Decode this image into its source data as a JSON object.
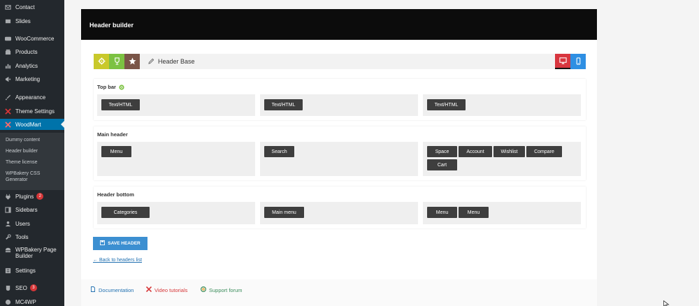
{
  "sidebar": {
    "items": [
      {
        "label": "Contact",
        "icon": "mail-icon"
      },
      {
        "label": "Slides",
        "icon": "slides-icon"
      },
      {
        "label": "WooCommerce",
        "icon": "woocommerce-icon"
      },
      {
        "label": "Products",
        "icon": "products-icon"
      },
      {
        "label": "Analytics",
        "icon": "analytics-icon"
      },
      {
        "label": "Marketing",
        "icon": "megaphone-icon"
      },
      {
        "label": "Appearance",
        "icon": "brush-icon"
      },
      {
        "label": "Theme Settings",
        "icon": "theme-settings-icon"
      },
      {
        "label": "WoodMart",
        "icon": "woodmart-icon"
      },
      {
        "label": "Plugins",
        "icon": "plugin-icon",
        "badge": "2"
      },
      {
        "label": "Sidebars",
        "icon": "sidebars-icon"
      },
      {
        "label": "Users",
        "icon": "users-icon"
      },
      {
        "label": "Tools",
        "icon": "wrench-icon"
      },
      {
        "label": "WPBakery Page Builder",
        "icon": "wpbakery-icon"
      },
      {
        "label": "Settings",
        "icon": "settings-icon"
      },
      {
        "label": "SEO",
        "icon": "seo-icon",
        "badge": "3"
      },
      {
        "label": "MC4WP",
        "icon": "mc4wp-icon"
      }
    ],
    "submenu": [
      "Dummy content",
      "Header builder",
      "Theme license",
      "WPBakery CSS Generator"
    ]
  },
  "panel": {
    "title": "Header builder",
    "toolbar": {
      "base_label": "Header Base",
      "left_icons": [
        "gear-icon",
        "trophy-icon",
        "star-icon"
      ],
      "right_icons": [
        "desktop-icon",
        "mobile-icon"
      ]
    },
    "sections": [
      {
        "title": "Top bar",
        "columns": [
          [
            "Text/HTML"
          ],
          [
            "Text/HTML"
          ],
          [
            "Text/HTML"
          ]
        ]
      },
      {
        "title": "Main header",
        "columns": [
          [
            "Menu"
          ],
          [
            "Search"
          ],
          [
            "Space",
            "Account",
            "Wishlist",
            "Compare",
            "Cart"
          ]
        ]
      },
      {
        "title": "Header bottom",
        "columns": [
          [
            "Categories"
          ],
          [
            "Main menu"
          ],
          [
            "Menu",
            "Menu"
          ]
        ]
      }
    ],
    "save_label": "SAVE HEADER",
    "back_label": "← Back to headers list",
    "footer": {
      "documentation": "Documentation",
      "video": "Video tutorials",
      "forum": "Support forum"
    }
  },
  "colors": {
    "sidebar_bg": "#23282d",
    "active": "#0073aa",
    "accent_blue": "#3c8fd1",
    "toolbar_yellow": "#c9c92b",
    "toolbar_green": "#7cc242",
    "toolbar_brown": "#7a5548",
    "toolbar_red": "#d8363f",
    "toolbar_blue": "#2e8fe3"
  }
}
